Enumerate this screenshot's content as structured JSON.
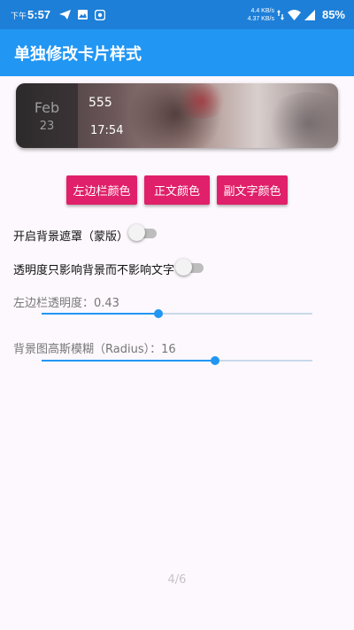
{
  "status_bar": {
    "time_prefix": "下午",
    "time": "5:57",
    "speed_up": "4.4 KB/s",
    "speed_down": "4.37 KB/s",
    "battery": "85%",
    "icons": [
      "send-icon",
      "image-icon",
      "app-icon",
      "data-arrows-icon",
      "wifi-icon",
      "signal-icon",
      "battery-icon"
    ]
  },
  "app_bar": {
    "title": "单独修改卡片样式"
  },
  "card": {
    "month": "Feb",
    "day": "23",
    "title": "555",
    "time": "17:54"
  },
  "buttons": {
    "left_color": "左边栏颜色",
    "body_color": "正文颜色",
    "subtext_color": "副文字颜色"
  },
  "toggles": {
    "background_mask": {
      "label": "开启背景遮罩（蒙版）",
      "on": false
    },
    "opacity_bg_only": {
      "label": "透明度只影响背景而不影响文字",
      "on": false
    }
  },
  "sliders": {
    "left_opacity": {
      "label": "左边栏透明度：0.43",
      "value": 0.43,
      "fraction": 0.43
    },
    "blur_radius": {
      "label": "背景图高斯模糊（Radius）：16",
      "value": 16,
      "fraction": 0.64
    }
  },
  "page_indicator": "4/6",
  "colors": {
    "status_bar": "#1d7fd8",
    "app_bar": "#2196f3",
    "button": "#e0206a",
    "slider": "#2196f3"
  }
}
